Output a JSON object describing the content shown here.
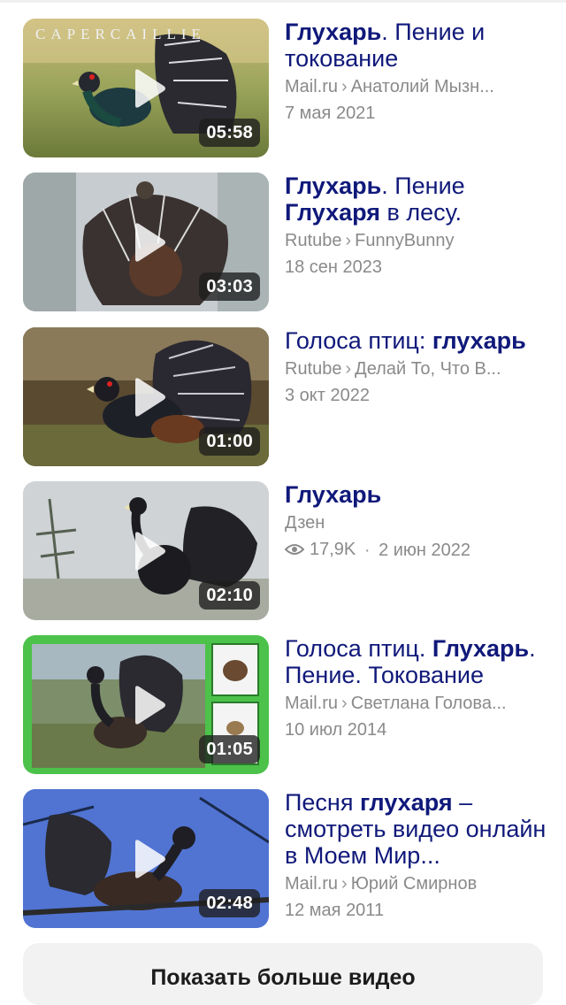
{
  "videos": [
    {
      "title_parts": [
        {
          "text": "Глухарь",
          "bold": true
        },
        {
          "text": ". Пение и токование",
          "bold": false
        }
      ],
      "source": "Mail.ru",
      "author": "Анатолий Мызн...",
      "date": "7 мая 2021",
      "duration": "05:58",
      "thumb_caption": "CAPERCAILLIE"
    },
    {
      "title_parts": [
        {
          "text": "Глухарь",
          "bold": true
        },
        {
          "text": ". Пение ",
          "bold": false
        },
        {
          "text": "Глухаря",
          "bold": true
        },
        {
          "text": " в лесу.",
          "bold": false
        }
      ],
      "source": "Rutube",
      "author": "FunnyBunny",
      "date": "18 сен 2023",
      "duration": "03:03"
    },
    {
      "title_parts": [
        {
          "text": "Голоса птиц: ",
          "bold": false
        },
        {
          "text": "глухарь",
          "bold": true
        }
      ],
      "source": "Rutube",
      "author": "Делай То, Что В...",
      "date": "3 окт 2022",
      "duration": "01:00"
    },
    {
      "title_parts": [
        {
          "text": "Глухарь",
          "bold": true
        }
      ],
      "source": "Дзен",
      "views": "17,9K",
      "date": "2 июн 2022",
      "duration": "02:10"
    },
    {
      "title_parts": [
        {
          "text": "Голоса птиц. ",
          "bold": false
        },
        {
          "text": "Глухарь",
          "bold": true
        },
        {
          "text": ". Пение. Токование",
          "bold": false
        }
      ],
      "source": "Mail.ru",
      "author": "Светлана Голова...",
      "date": "10 июл 2014",
      "duration": "01:05"
    },
    {
      "title_parts": [
        {
          "text": "Песня ",
          "bold": false
        },
        {
          "text": "глухаря",
          "bold": true
        },
        {
          "text": " – смотреть видео онлайн в Моем Мир...",
          "bold": false
        }
      ],
      "source": "Mail.ru",
      "author": "Юрий Смирнов",
      "date": "12 мая 2011",
      "duration": "02:48"
    }
  ],
  "more_button_label": "Показать больше видео",
  "icons": {
    "play": "play-icon",
    "views": "eye-icon"
  },
  "colors": {
    "title": "#10197a",
    "meta": "#8a8a8a",
    "button_bg": "#f2f2f2"
  }
}
